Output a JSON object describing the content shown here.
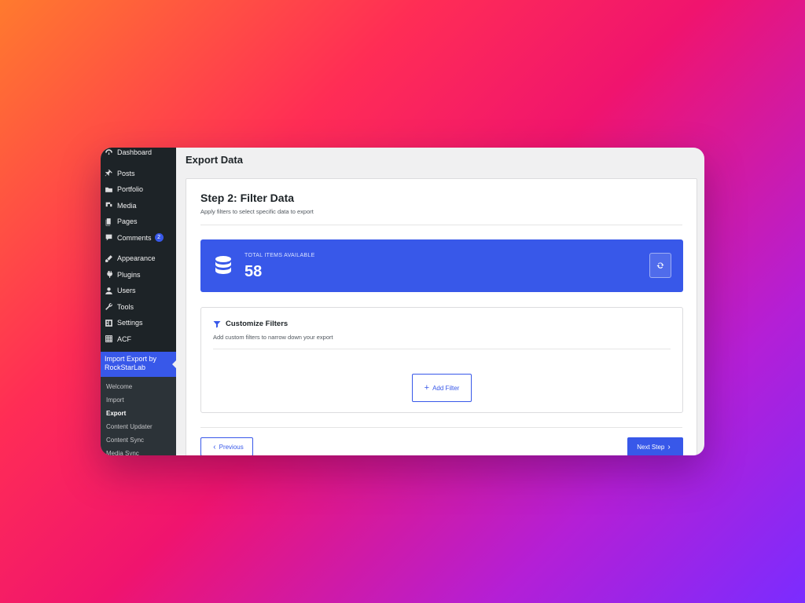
{
  "sidebar": {
    "items": [
      {
        "label": "Dashboard",
        "icon": "dashboard-icon"
      },
      {
        "label": "Posts",
        "icon": "pin-icon"
      },
      {
        "label": "Portfolio",
        "icon": "folder-icon"
      },
      {
        "label": "Media",
        "icon": "media-icon"
      },
      {
        "label": "Pages",
        "icon": "pages-icon"
      },
      {
        "label": "Comments",
        "icon": "comment-icon",
        "badge": "2"
      },
      {
        "label": "Appearance",
        "icon": "brush-icon"
      },
      {
        "label": "Plugins",
        "icon": "plugin-icon"
      },
      {
        "label": "Users",
        "icon": "user-icon"
      },
      {
        "label": "Tools",
        "icon": "wrench-icon"
      },
      {
        "label": "Settings",
        "icon": "settings-icon"
      },
      {
        "label": "ACF",
        "icon": "grid-icon"
      }
    ],
    "active": {
      "label": "Import Export by RockStarLab",
      "icon": "sync-icon"
    },
    "submenu": [
      "Welcome",
      "Import",
      "Export",
      "Content Updater",
      "Content Sync",
      "Media Sync"
    ],
    "current_sub": "Export"
  },
  "page": {
    "title": "Export Data",
    "step_title": "Step 2: Filter Data",
    "step_subtitle": "Apply filters to select specific data to export"
  },
  "stats": {
    "label": "TOTAL ITEMS AVAILABLE",
    "value": "58"
  },
  "filters": {
    "title": "Customize Filters",
    "subtitle": "Add custom filters to narrow down your export",
    "add_label": "Add Filter"
  },
  "nav": {
    "previous": "Previous",
    "next": "Next Step"
  },
  "colors": {
    "accent": "#3858e9",
    "sidebar_bg": "#1d2327"
  }
}
